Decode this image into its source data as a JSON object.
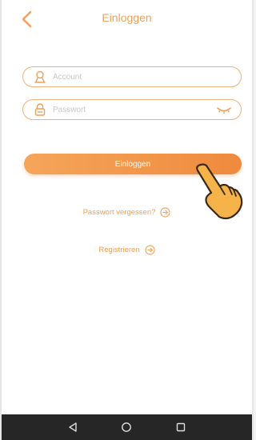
{
  "header": {
    "title": "Einloggen"
  },
  "form": {
    "account_placeholder": "Account",
    "password_placeholder": "Passwort",
    "login_label": "Einloggen"
  },
  "links": {
    "forgot_password": "Passwort vergessen?",
    "register": "Registrieren"
  },
  "colors": {
    "accent": "#f0a05a",
    "button": "#ef8a3e",
    "navbar": "#262626"
  },
  "icons": [
    "back-chevron-icon",
    "user-icon",
    "lock-icon",
    "eye-closed-icon",
    "arrow-circle-right-icon",
    "pointing-hand-icon",
    "nav-back-icon",
    "nav-home-icon",
    "nav-recents-icon"
  ]
}
